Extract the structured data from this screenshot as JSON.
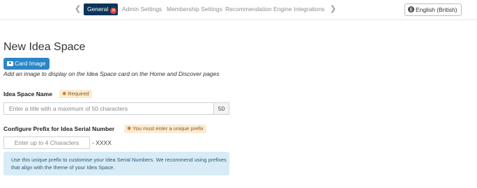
{
  "nav": {
    "tabs": [
      {
        "label": "General",
        "active": true
      },
      {
        "label": "Admin Settings"
      },
      {
        "label": "Membership Settings"
      },
      {
        "label": "Recommendation Engine"
      },
      {
        "label": "Integrations"
      }
    ],
    "prev_icon": "chevron-left-icon",
    "next_icon": "chevron-right-icon",
    "active_color": "#0b3559",
    "close_color": "#e8433b"
  },
  "language": {
    "label": "English (British)",
    "icon": "globe-icon"
  },
  "page": {
    "title": "New Idea Space"
  },
  "card_image": {
    "button_label": "Card Image",
    "icon": "camera-icon",
    "help": "Add an image to display on the Idea Space card on the Home and Discover pages",
    "button_color": "#2b86c6"
  },
  "name_field": {
    "label": "Idea Space Name",
    "badge": "Required",
    "placeholder": "Enter a title with a maximum of 50 characters",
    "counter": "50"
  },
  "prefix_field": {
    "label": "Configure Prefix for Idea Serial Number",
    "badge": "You must enter a unique prefix",
    "placeholder": "Enter up to 4 Characters",
    "suffix": "- XXXX",
    "info": "Use this unique prefix to customise your Idea Serial Numbers. We recommend using prefixes that align with the theme of your Idea Space."
  }
}
